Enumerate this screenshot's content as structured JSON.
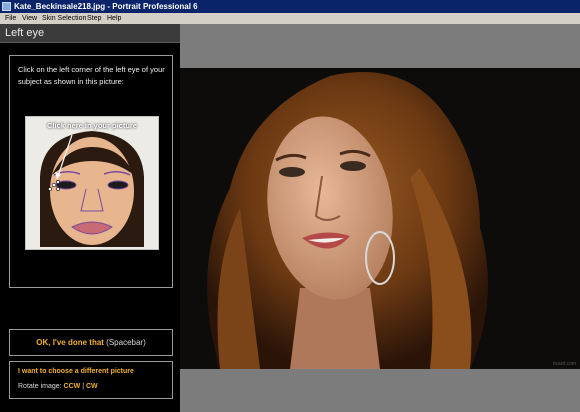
{
  "window": {
    "title": "Kate_Beckinsale218.jpg - Portrait Professional 6"
  },
  "menu": [
    "File",
    "View",
    "Skin Selection",
    "Step",
    "Help"
  ],
  "panel": {
    "header": "Left eye",
    "instruction": "Click on the left corner of the left eye of your subject as shown in this picture:",
    "ref_caption": "Click here in your picture",
    "done_label": "OK, I've done that",
    "done_hint": "(Spacebar)",
    "choose_link": "I want to choose a different picture",
    "rotate_label": "Rotate image:",
    "rotate_ccw": "CCW",
    "rotate_sep": "|",
    "rotate_cw": "CW"
  },
  "photo": {
    "watermark": "rizard.com"
  },
  "colors": {
    "titlebar": "#0a246a",
    "accent": "#f0b030",
    "panel_bg": "#000000",
    "viewer_bg": "#7c7c7c"
  }
}
